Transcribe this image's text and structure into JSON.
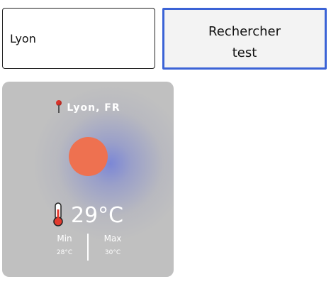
{
  "search": {
    "value": "Lyon",
    "button_line1": "Rechercher",
    "button_line2": "test"
  },
  "weather": {
    "location": "Lyon, FR",
    "location_icon": "pin-icon",
    "condition_icon": "sun-icon",
    "temperature": "29°C",
    "min_label": "Min",
    "min_value": "28°C",
    "max_label": "Max",
    "max_value": "30°C"
  },
  "colors": {
    "button_border": "#3b63d6",
    "card_background": "#c0c0c0",
    "sun": "#ee7150",
    "glow": "#7884d7"
  }
}
